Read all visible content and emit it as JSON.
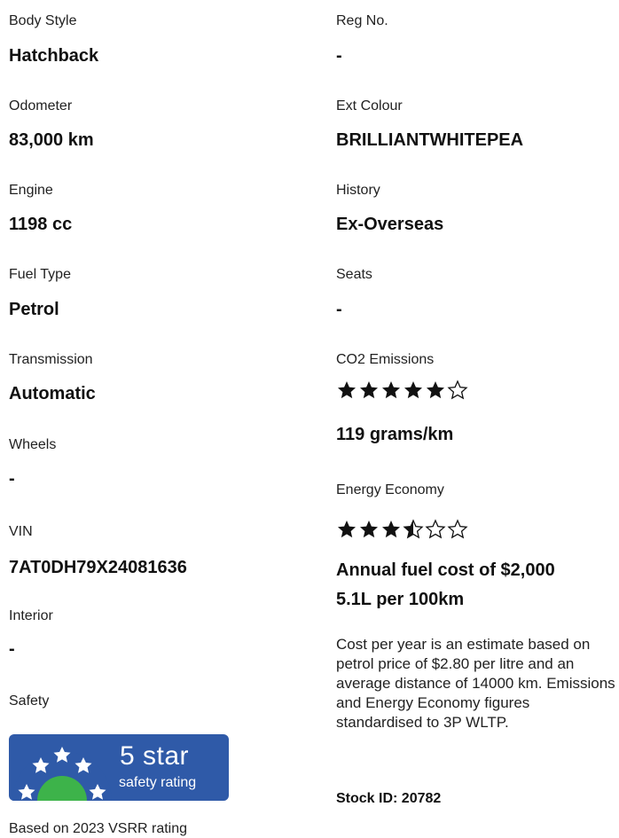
{
  "left": {
    "body_style": {
      "label": "Body Style",
      "value": "Hatchback"
    },
    "odometer": {
      "label": "Odometer",
      "value": "83,000 km"
    },
    "engine": {
      "label": "Engine",
      "value": "1198 cc"
    },
    "fuel_type": {
      "label": "Fuel Type",
      "value": "Petrol"
    },
    "transmission": {
      "label": "Transmission",
      "value": "Automatic"
    },
    "wheels": {
      "label": "Wheels",
      "value": "-"
    },
    "vin": {
      "label": "VIN",
      "value": "7AT0DH79X24081636"
    },
    "interior": {
      "label": "Interior",
      "value": "-"
    },
    "safety": {
      "label": "Safety",
      "badge": {
        "line1": "5 star",
        "line2": "safety rating",
        "stars": 5
      },
      "note": "Based on 2023 VSRR rating"
    }
  },
  "right": {
    "reg_no": {
      "label": "Reg No.",
      "value": "-"
    },
    "ext_colour": {
      "label": "Ext Colour",
      "value": "BRILLIANTWHITEPEA"
    },
    "history": {
      "label": "History",
      "value": "Ex-Overseas"
    },
    "seats": {
      "label": "Seats",
      "value": "-"
    },
    "co2": {
      "label": "CO2 Emissions",
      "rating": 5,
      "max": 6,
      "value": "119 grams/km"
    },
    "energy": {
      "label": "Energy Economy",
      "rating": 3.5,
      "max": 6
    },
    "annual_fuel_cost": "Annual fuel cost of $2,000",
    "consumption": "5.1L per 100km",
    "note": "Cost per year is an estimate based on petrol price of  $2.80 per litre and an average distance of 14000 km. Emissions and Energy Economy figures standardised to 3P WLTP.",
    "stock_id": "Stock ID: 20782"
  },
  "colors": {
    "badge_blue": "#2f5aa8",
    "badge_green": "#3db34a",
    "star": "#111111"
  }
}
